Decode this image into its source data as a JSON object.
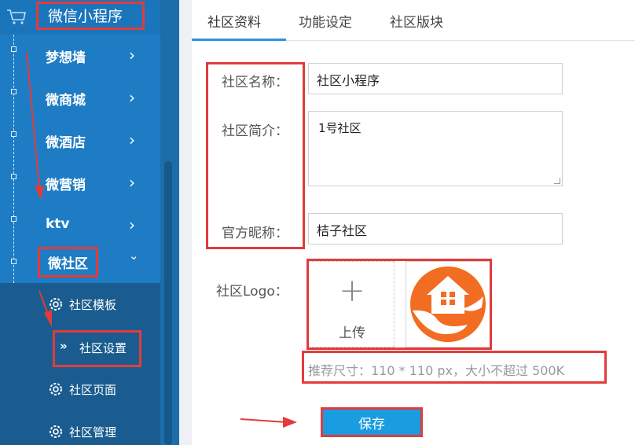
{
  "sidebar": {
    "app_title": "微信小程序",
    "items": [
      {
        "label": "梦想墙"
      },
      {
        "label": "微商城"
      },
      {
        "label": "微酒店"
      },
      {
        "label": "微营销"
      },
      {
        "label": "ktv"
      },
      {
        "label": "微社区"
      }
    ],
    "chevron_closed": "›",
    "chevron_open": "⌄",
    "submenu": [
      {
        "label": "社区模板"
      },
      {
        "label": "社区设置",
        "active_glyph": "»"
      },
      {
        "label": "社区页面"
      },
      {
        "label": "社区管理"
      }
    ]
  },
  "tabs": [
    {
      "label": "社区资料"
    },
    {
      "label": "功能设定"
    },
    {
      "label": "社区版块"
    }
  ],
  "form": {
    "name_label": "社区名称：",
    "name_value": "社区小程序",
    "intro_label": "社区简介：",
    "intro_value": "1号社区",
    "nickname_label": "官方昵称：",
    "nickname_value": "桔子社区",
    "logo_label": "社区Logo：",
    "upload_plus": "+",
    "upload_label": "上传",
    "hint": "推荐尺寸：110 * 110 px，大小不超过 500K",
    "save_label": "保存"
  },
  "colors": {
    "sidebar_bg": "#1e7cc4",
    "submenu_bg": "#1a5c8f",
    "accent": "#1a9ce0",
    "highlight_red": "#e23b3b",
    "logo_orange": "#f26c22"
  }
}
